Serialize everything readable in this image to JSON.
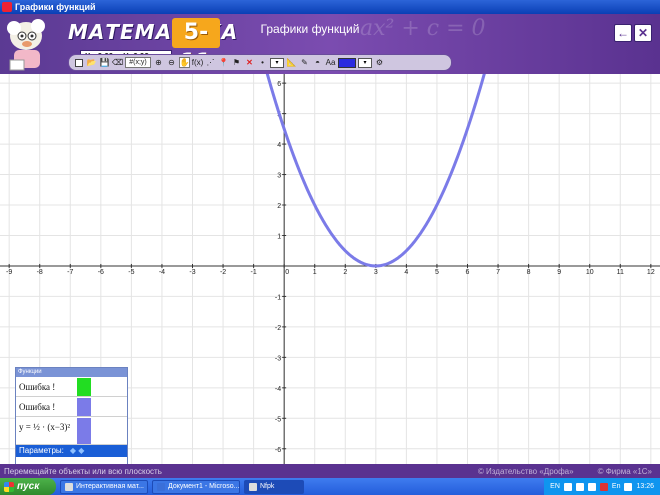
{
  "window": {
    "title": "Графики функций"
  },
  "header": {
    "logo_text": "МАТЕМАТИКА",
    "logo_grades": "5-11",
    "coord_x": "X=-2,29",
    "coord_y": "Y=2,93",
    "app_title": "Графики функций",
    "bg_formula": "ax² + c = 0",
    "back_btn": "←",
    "close_btn": "✕"
  },
  "toolbar": {
    "items": [
      "new-icon",
      "open-icon",
      "save-icon",
      "eraser-icon",
      "grid-icon",
      "xy-icon",
      "zoom-in-icon",
      "zoom-out-icon",
      "hand-icon",
      "fx-icon",
      "dotted-line-icon",
      "pin-icon",
      "point-icon",
      "delete-icon",
      "dot-icon",
      "dropdown-icon",
      "ruler-icon",
      "pencil-icon",
      "protractor-icon",
      "text-icon",
      "line-style-icon",
      "color-icon"
    ],
    "grid_label": "(x;y)",
    "fx_label": "f(x)",
    "text_label": "Аа"
  },
  "chart_data": {
    "type": "line",
    "title": "",
    "xlim": [
      -9.3,
      12.3
    ],
    "ylim": [
      -6.5,
      6.3
    ],
    "x_ticks": [
      -9,
      -8,
      -7,
      -6,
      -5,
      -4,
      -3,
      -2,
      -1,
      0,
      1,
      2,
      3,
      4,
      5,
      6,
      7,
      8,
      9,
      10,
      11,
      12
    ],
    "y_ticks": [
      -6,
      -5,
      -4,
      -3,
      -2,
      -1,
      0,
      1,
      2,
      3,
      4,
      5,
      6
    ],
    "x_tick_labels": [
      "-9",
      "-8",
      "-7",
      "-6",
      "-5",
      "-4",
      "-3",
      "-2",
      "-1",
      "0",
      "1",
      "2",
      "3",
      "4",
      "5",
      "6",
      "7",
      "8",
      "9",
      "10",
      "11",
      "12"
    ],
    "y_tick_labels": [
      "-6",
      "-5",
      "-4",
      "-3",
      "-2",
      "-1",
      "",
      "1",
      "2",
      "3",
      "4",
      "5",
      "6"
    ],
    "grid": true,
    "series": [
      {
        "function": "0.5*(x-3)^2",
        "color": "#7b7be8",
        "x_range": [
          -0.6,
          6.6
        ]
      }
    ]
  },
  "functions_panel": {
    "title": "Функции",
    "rows": [
      {
        "text": "Ошибка !",
        "color": "#22dd22"
      },
      {
        "text": "Ошибка !",
        "color": "#7b7be8"
      },
      {
        "text": "y = ½ · (x−3)²",
        "color": "#7b7be8"
      }
    ],
    "params_label": "Параметры:"
  },
  "status": {
    "message": "Перемещайте объекты или всю плоскость",
    "copyright1": "© Издательство «Дрофа»",
    "copyright2": "© Фирма «1С»"
  },
  "taskbar": {
    "start_label": "пуск",
    "tasks": [
      "Интерактивная мат...",
      "Документ1 - Microso...",
      "Nfpk"
    ],
    "lang": "EN",
    "lang2": "En",
    "clock": "13:26"
  }
}
